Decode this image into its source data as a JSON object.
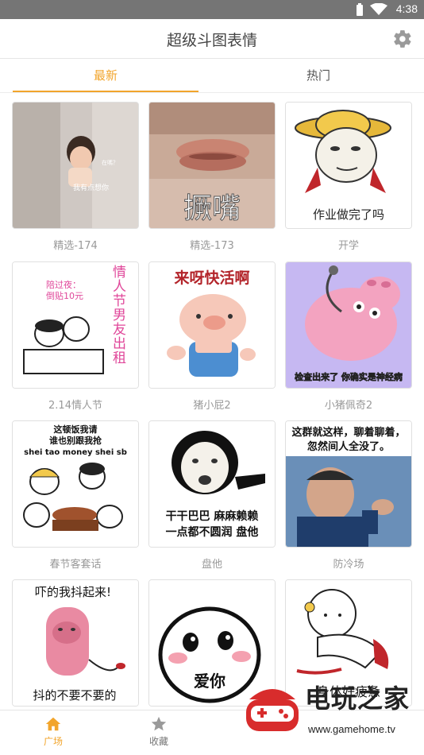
{
  "status_bar": {
    "time": "4:38"
  },
  "app_bar": {
    "title": "超级斗图表情"
  },
  "tabs": [
    {
      "label": "最新"
    },
    {
      "label": "热门"
    }
  ],
  "grid": {
    "items": [
      {
        "caption": "精选-174",
        "overlay": [
          "在嗎？",
          "我有点想你"
        ]
      },
      {
        "caption": "精选-173",
        "overlay": [
          "撅嘴"
        ]
      },
      {
        "caption": "开学",
        "overlay": [
          "作业做完了吗"
        ]
      },
      {
        "caption": "2.14情人节",
        "overlay": [
          "陪过夜：",
          "倒贴10元",
          "情",
          "人",
          "节",
          "男",
          "友",
          "出",
          "租"
        ]
      },
      {
        "caption": "猪小屁2",
        "overlay": [
          "来呀快活啊"
        ]
      },
      {
        "caption": "小猪佩奇2",
        "overlay": [
          "检查出来了 你确实是神经病"
        ]
      },
      {
        "caption": "春节客套话",
        "overlay": [
          "这顿饭我请",
          "谁也别跟我抢",
          "shei tao money shei sb"
        ]
      },
      {
        "caption": "盘他",
        "overlay": [
          "干干巴巴 麻麻赖赖",
          "一点都不圆润 盘他"
        ]
      },
      {
        "caption": "防冷场",
        "overlay": [
          "这群就这样，聊着聊着，",
          "忽然间人全没了。"
        ]
      },
      {
        "caption": "",
        "overlay": [
          "吓的我抖起来!",
          "抖的不要不要的"
        ]
      },
      {
        "caption": "",
        "overlay": [
          "爱你"
        ]
      },
      {
        "caption": "",
        "overlay": [
          "身体好疲惫"
        ]
      }
    ]
  },
  "bottom_nav": [
    {
      "label": "广场",
      "icon": "home-icon"
    },
    {
      "label": "收藏",
      "icon": "star-icon"
    }
  ],
  "watermark": {
    "name": "电玩之家",
    "url": "www.gamehome.tv"
  },
  "colors": {
    "accent": "#f2a52c",
    "status_bar": "#757575"
  }
}
